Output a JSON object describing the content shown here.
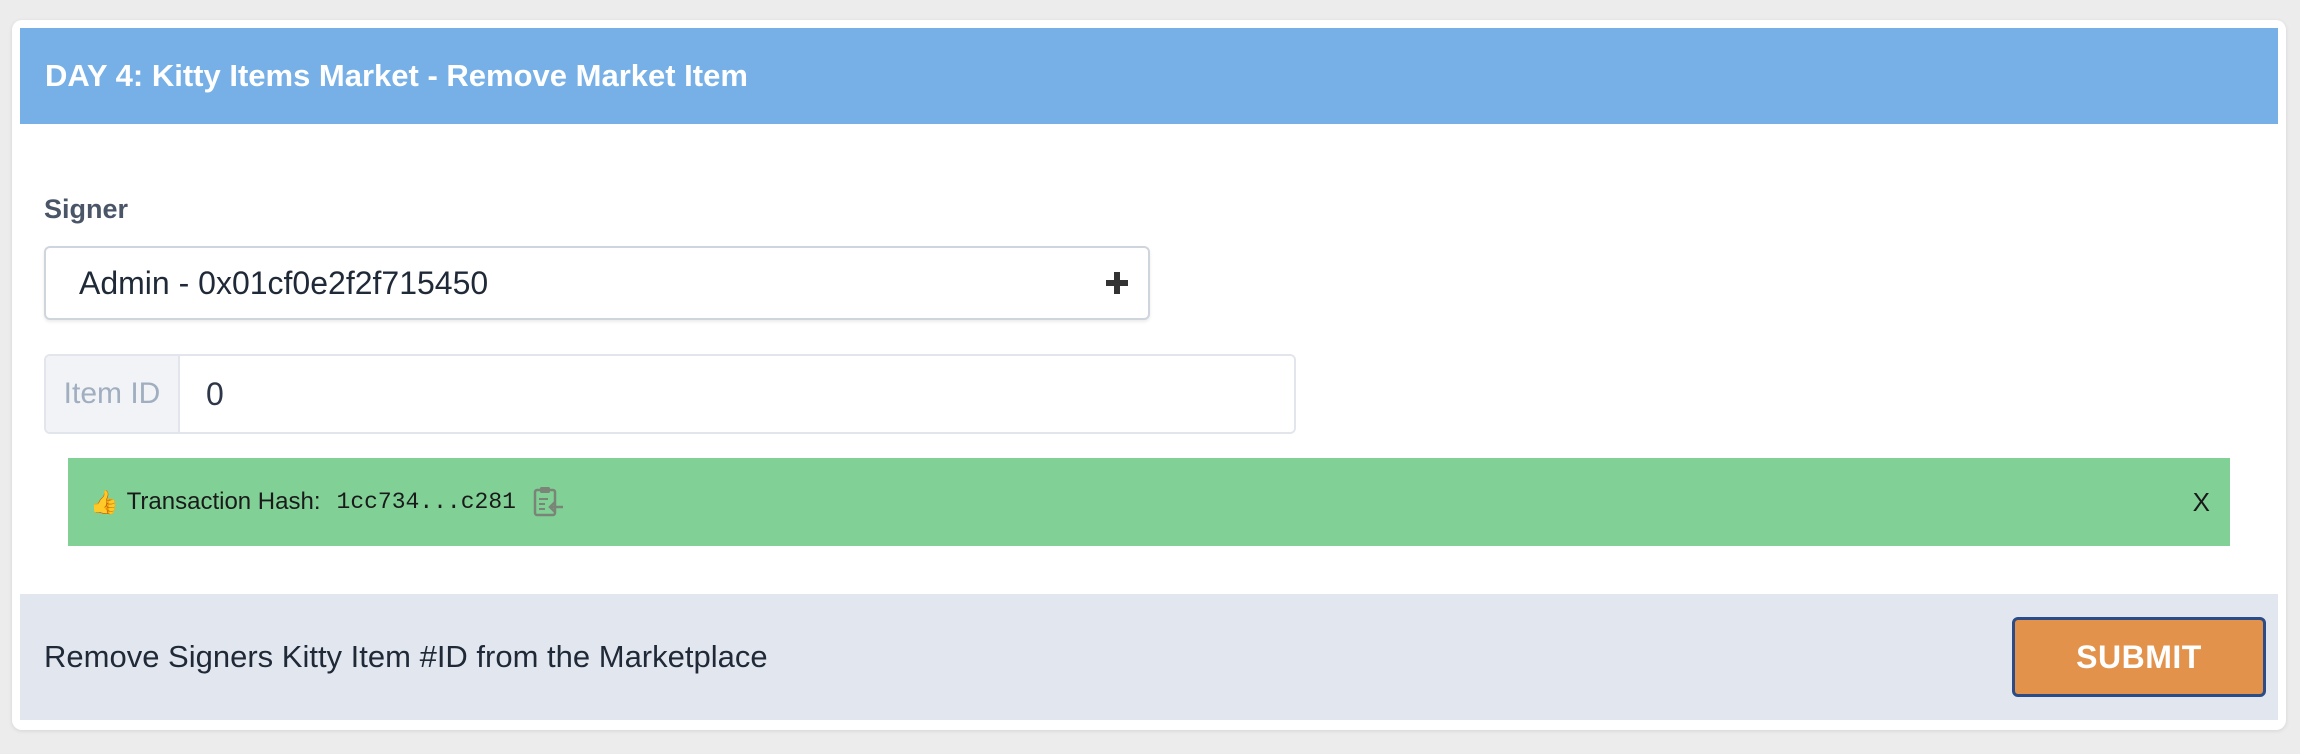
{
  "header": {
    "title": "DAY 4: Kitty Items Market - Remove Market Item"
  },
  "signer": {
    "label": "Signer",
    "selected": "Admin - 0x01cf0e2f2f715450",
    "add_icon": "plus-icon"
  },
  "item": {
    "addon_label": "Item ID",
    "value": "0"
  },
  "transaction": {
    "emoji": "👍",
    "label": "Transaction Hash:",
    "hash": "1cc734...c281",
    "copy_icon": "clipboard-icon",
    "close_label": "X",
    "color": "#81d196"
  },
  "footer": {
    "description": "Remove Signers Kitty Item #ID from the Marketplace",
    "submit_label": "SUBMIT"
  },
  "colors": {
    "header": "#76b0e7",
    "submit": "#e2924a",
    "submit_border": "#2c4c87",
    "footer_bg": "#e2e7ef"
  }
}
